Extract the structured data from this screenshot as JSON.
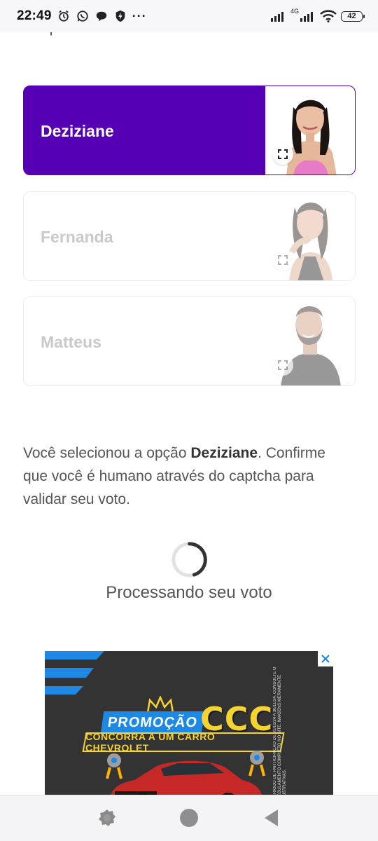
{
  "status_bar": {
    "time": "22:49",
    "dots": "···",
    "network_label": "4G",
    "battery": "42"
  },
  "page": {
    "cut_off_text": "temporada."
  },
  "options": [
    {
      "name": "Deziziane",
      "selected": true
    },
    {
      "name": "Fernanda",
      "selected": false
    },
    {
      "name": "Matteus",
      "selected": false
    }
  ],
  "confirmation": {
    "prefix": "Você selecionou a opção ",
    "selected_name": "Deziziane",
    "suffix": ". Confirme que você é humano através do captcha para validar seu voto."
  },
  "processing": {
    "label": "Processando seu voto"
  },
  "ad": {
    "promo_label": "PROMOÇÃO",
    "brand": "CCC",
    "tagline": "CONCORRA A UM CARRO CHEVROLET",
    "fine_print": "PERÍODO DE PARTICIPAÇÃO DE 01/10/24 A 30/11/24. CONSULTE O REGULAMENTO COMPLETO NO SITE. IMAGENS MERAMENTE ILUSTRATIVAS."
  },
  "colors": {
    "selected_card": "#5500b4",
    "ad_background": "#333333",
    "ad_yellow": "#f6d32e",
    "ad_blue": "#1e88e5"
  }
}
